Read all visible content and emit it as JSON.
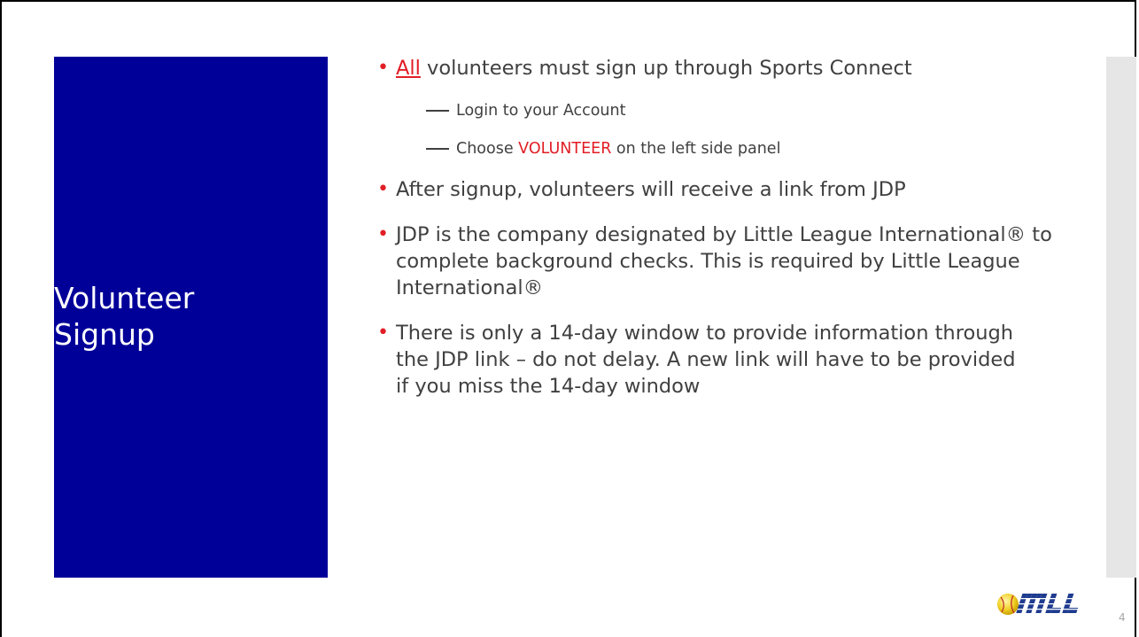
{
  "slide": {
    "title": "Volunteer\nSignup",
    "page_number": "4",
    "logo_text": "MLL"
  },
  "bullets": [
    {
      "highlight": "All",
      "text": " volunteers must sign up through Sports Connect",
      "subs": [
        {
          "pre": "Login to your Account",
          "highlight": "",
          "post": ""
        },
        {
          "pre": "Choose ",
          "highlight": "VOLUNTEER",
          "post": " on the left side panel"
        }
      ]
    },
    {
      "text": "After signup, volunteers will receive a link from JDP"
    },
    {
      "text": "JDP is the company designated by Little League International® to complete background checks.  This is required by Little League International®"
    },
    {
      "text": "There is only a 14-day window to provide information through the JDP link – do not delay.  A new link will have to be provided if you miss the 14-day window"
    }
  ],
  "colors": {
    "title_panel": "#000099",
    "accent_red": "#e11e25",
    "body_text": "#404040"
  }
}
